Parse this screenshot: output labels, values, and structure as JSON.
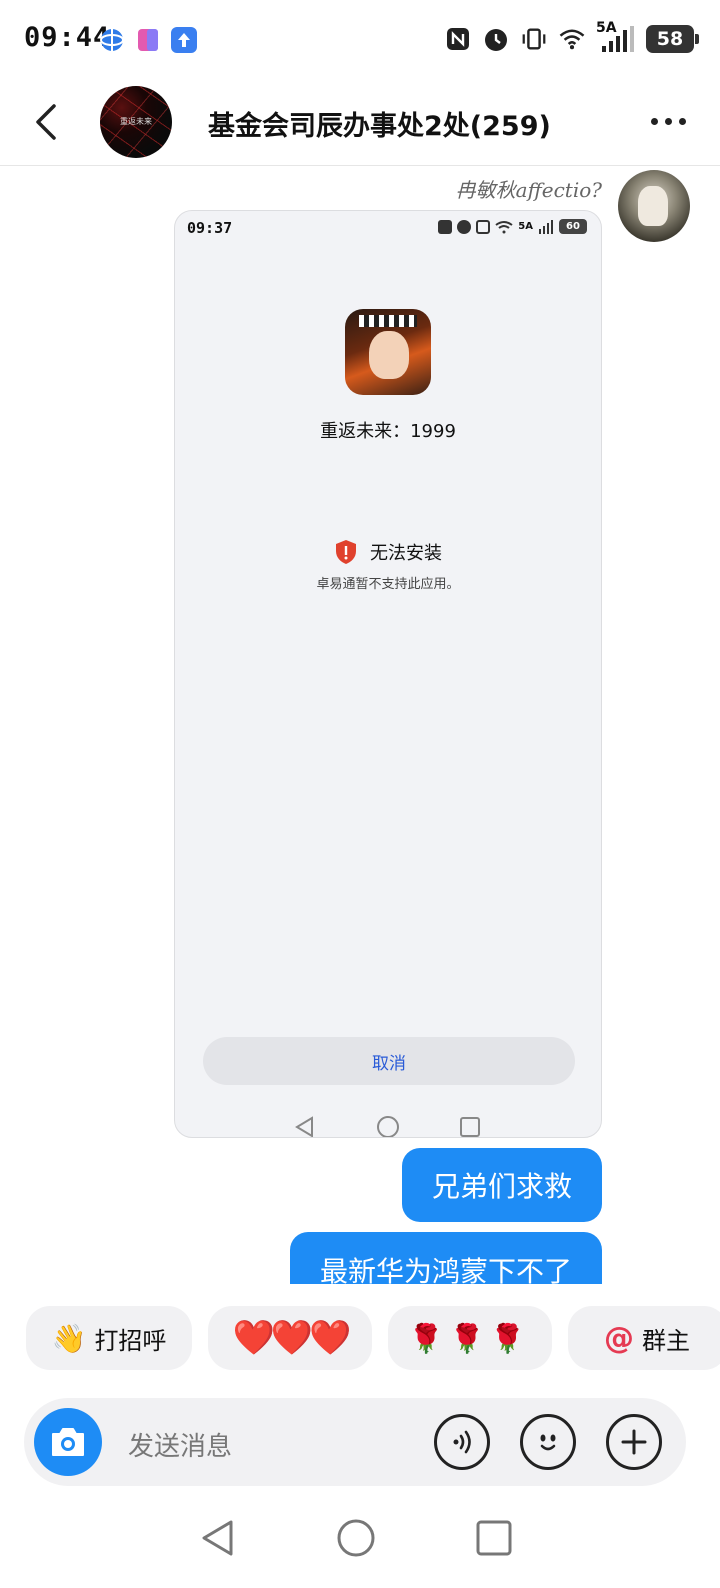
{
  "status_bar": {
    "time": "09:44",
    "network": "5A",
    "battery": "58"
  },
  "header": {
    "title": "基金会司辰办事处2处(259)",
    "avatar_text": "重返未来"
  },
  "messages": {
    "sender_name": "冉敏秋affectio?",
    "screenshot": {
      "time": "09:37",
      "network": "5A",
      "battery": "60",
      "app_name": "重返未来：1999",
      "error_title": "无法安装",
      "error_detail": "卓易通暂不支持此应用。",
      "cancel_label": "取消"
    },
    "bubble_1": "兄弟们求救",
    "bubble_2": "最新华为鸿蒙下不了"
  },
  "quick_replies": [
    {
      "label": "打招呼",
      "icon": "waving-hand-emoji"
    },
    {
      "label": "❤️❤️❤️",
      "icon": "hearts"
    },
    {
      "label": "🌹🌹🌹",
      "icon": "roses"
    },
    {
      "label": "群主",
      "icon": "at-sign"
    }
  ],
  "input": {
    "placeholder": "发送消息"
  },
  "colors": {
    "accent": "#1e8cf5",
    "bubble_text": "#ffffff",
    "warning": "#e0412d",
    "cancel_text": "#2a5bd7"
  }
}
